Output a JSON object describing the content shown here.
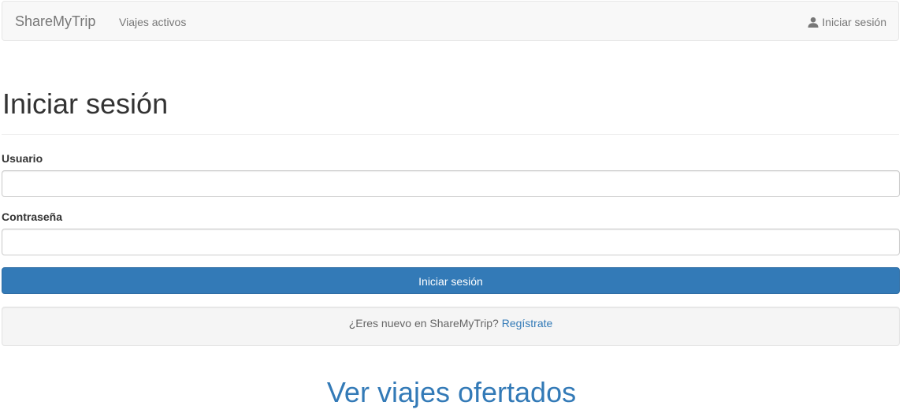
{
  "navbar": {
    "brand": "ShareMyTrip",
    "active_trips_link": "Viajes activos",
    "login_link": "Iniciar sesión",
    "login_icon": "user-icon"
  },
  "page": {
    "title": "Iniciar sesión"
  },
  "form": {
    "username_label": "Usuario",
    "username_value": "",
    "password_label": "Contraseña",
    "password_value": "",
    "submit_label": "Iniciar sesión"
  },
  "register": {
    "prompt": "¿Eres nuevo en ShareMyTrip?",
    "link_label": "Regístrate"
  },
  "offers": {
    "link_label": "Ver viajes ofertados"
  },
  "colors": {
    "primary": "#337ab7",
    "navbar_bg": "#f8f8f8",
    "well_bg": "#f5f5f5"
  }
}
